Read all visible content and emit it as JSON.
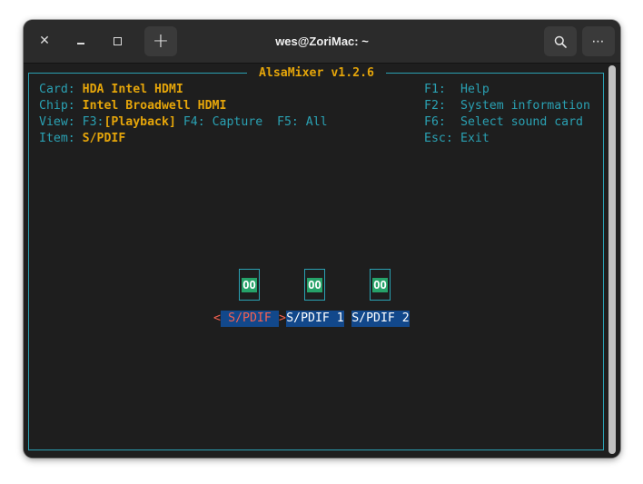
{
  "window": {
    "title": "wes@ZoriMac: ~",
    "close_glyph": "✕",
    "newtab_glyph": "+",
    "menu_glyph": "⋯",
    "icons": [
      "close-icon",
      "minimize-icon",
      "maximize-icon",
      "plus-icon",
      "search-icon",
      "menu-icon"
    ]
  },
  "mixer": {
    "title": " AlsaMixer v1.2.6 ",
    "info": {
      "card_label": "Card: ",
      "card_value": "HDA Intel HDMI",
      "chip_label": "Chip: ",
      "chip_value": "Intel Broadwell HDMI",
      "view_label": "View: ",
      "view_f3_key": "F3:",
      "view_f3_value": "[Playback]",
      "view_rest": " F4: Capture  F5: All",
      "item_label": "Item: ",
      "item_value": "S/PDIF"
    },
    "help": [
      {
        "key": "F1:",
        "label": "Help"
      },
      {
        "key": "F2:",
        "label": "System information"
      },
      {
        "key": "F6:",
        "label": "Select sound card"
      },
      {
        "key": "Esc:",
        "label": "Exit"
      }
    ],
    "channels": [
      {
        "name": "S/PDIF",
        "value": "OO",
        "selected": true
      },
      {
        "name": "S/PDIF 1",
        "value": "OO",
        "selected": false
      },
      {
        "name": "S/PDIF 2",
        "value": "OO",
        "selected": false
      }
    ],
    "arrow_left": "<",
    "arrow_right": ">"
  },
  "colors": {
    "accent_cyan": "#2aa1b3",
    "accent_orange": "#e5a50a",
    "meter_green": "#26a269",
    "channel_blue": "#12488b",
    "selected_red": "#f66151"
  }
}
